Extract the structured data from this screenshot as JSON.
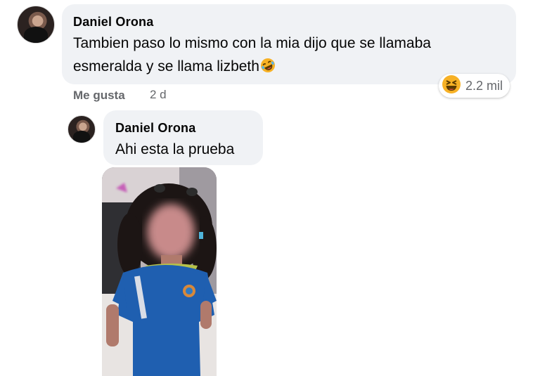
{
  "comment": {
    "author": "Daniel Orona",
    "line1": "Tambien paso lo mismo con la mia dijo que se llamaba",
    "line2": "esmeralda y se llama lizbeth",
    "inline_emoji": "rolling-on-floor-laughing-icon",
    "reaction": {
      "icon": "haha-reaction-icon",
      "count": "2.2 mil"
    },
    "like_label": "Me gusta",
    "time": "2 d"
  },
  "reply": {
    "author": "Daniel Orona",
    "text": "Ahi esta la prueba",
    "attachment": "photo-attachment"
  },
  "colors": {
    "bubble": "#f0f2f5",
    "meta_text": "#65676b",
    "reaction_yellow": "#f7b125"
  }
}
